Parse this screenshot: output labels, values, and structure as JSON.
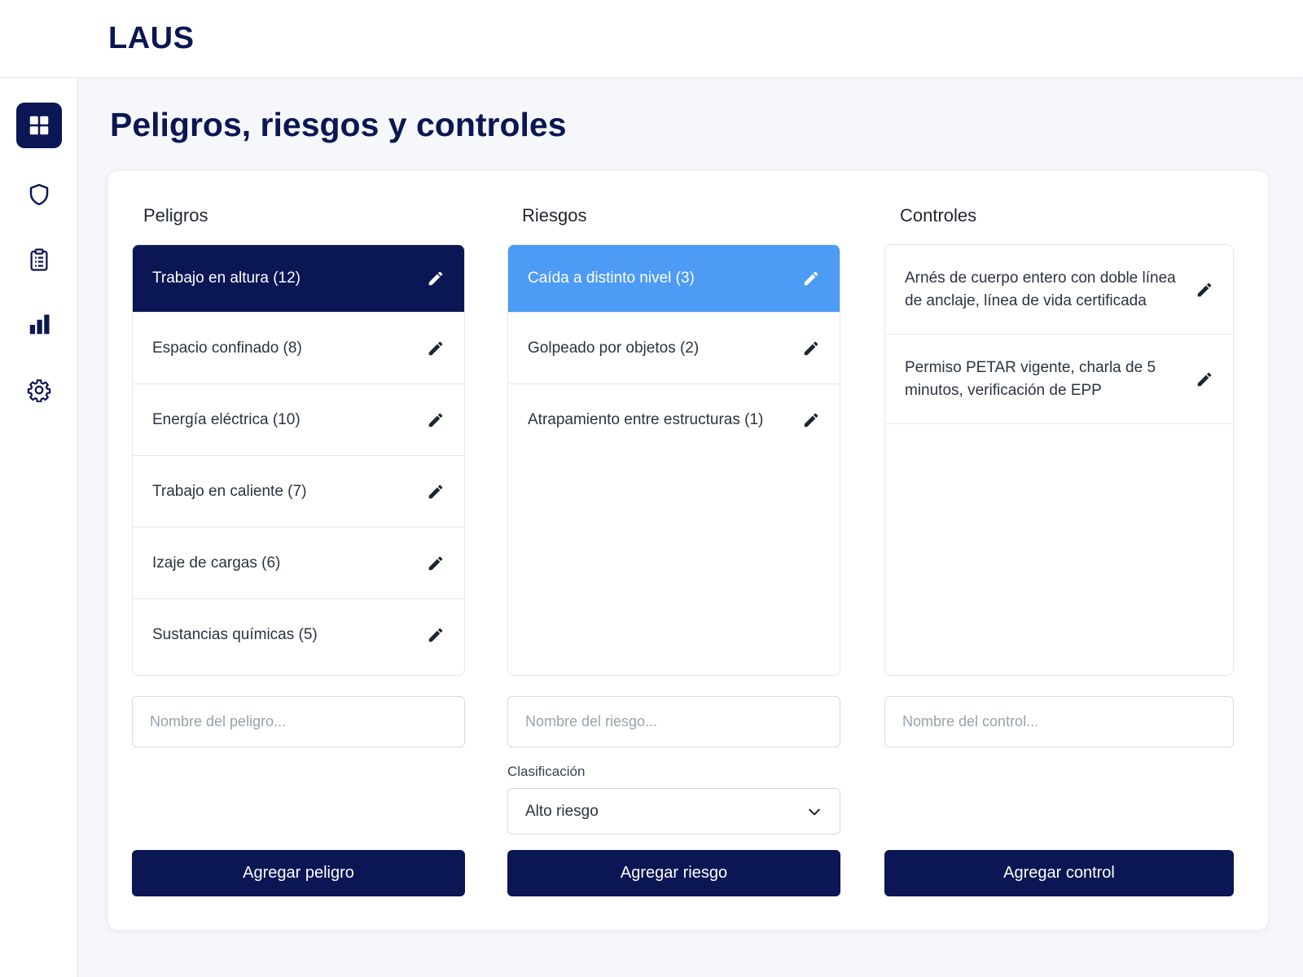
{
  "app": {
    "title": "LAUS"
  },
  "sidebar": {
    "items": [
      {
        "icon": "grid-icon",
        "active": true
      },
      {
        "icon": "shield-icon",
        "active": false
      },
      {
        "icon": "clipboard-icon",
        "active": false
      },
      {
        "icon": "bar-chart-icon",
        "active": false
      },
      {
        "icon": "gear-icon",
        "active": false
      }
    ]
  },
  "page": {
    "title": "Peligros, riesgos y controles"
  },
  "colors": {
    "primary": "#0b1654",
    "selected_blue": "#4c9bf5",
    "background": "#f5f7fb"
  },
  "peligros": {
    "title": "Peligros",
    "items": [
      {
        "label": "Trabajo en altura (12)",
        "selected": true
      },
      {
        "label": "Espacio confinado (8)"
      },
      {
        "label": "Energía eléctrica (10)"
      },
      {
        "label": "Trabajo en caliente (7)"
      },
      {
        "label": "Izaje de cargas (6)"
      },
      {
        "label": "Sustancias químicas (5)"
      }
    ],
    "input_placeholder": "Nombre del peligro...",
    "button": "Agregar peligro"
  },
  "riesgos": {
    "title": "Riesgos",
    "items": [
      {
        "label": "Caída a distinto nivel (3)",
        "selected": true
      },
      {
        "label": "Golpeado por objetos (2)"
      },
      {
        "label": "Atrapamiento entre estructuras (1)"
      }
    ],
    "input_placeholder": "Nombre del riesgo...",
    "classification_label": "Clasificación",
    "classification_value": "Alto riesgo",
    "button": "Agregar riesgo"
  },
  "controles": {
    "title": "Controles",
    "items": [
      {
        "label": "Arnés de cuerpo entero con doble línea de anclaje, línea de vida certificada"
      },
      {
        "label": "Permiso PETAR vigente, charla de 5 minutos, verificación de EPP"
      }
    ],
    "input_placeholder": "Nombre del control...",
    "button": "Agregar control"
  }
}
